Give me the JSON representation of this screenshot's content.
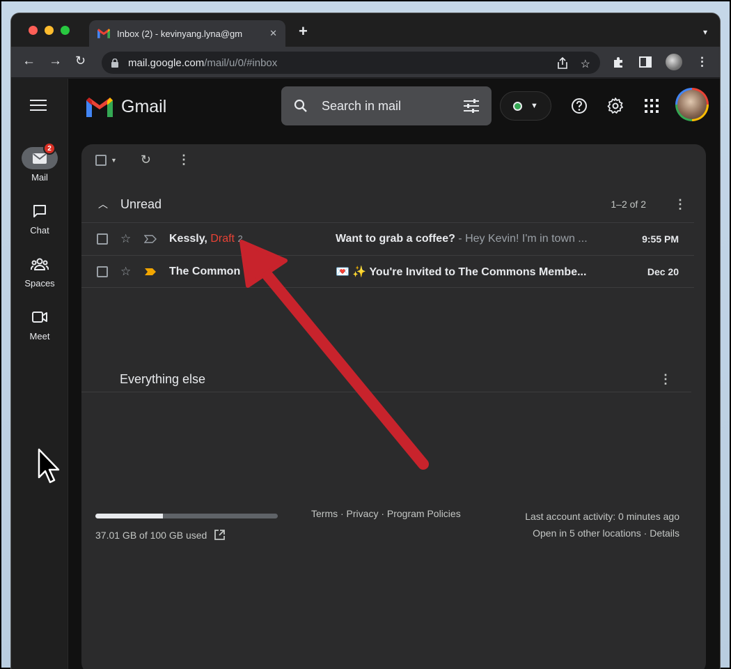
{
  "browser": {
    "tab_title": "Inbox (2) - kevinyang.lyna@gm",
    "tab_close": "✕",
    "new_tab": "+",
    "url_host": "mail.google.com",
    "url_path": "/mail/u/0/#inbox"
  },
  "rail": {
    "items": [
      {
        "label": "Mail",
        "icon": "mail-icon",
        "badge": "2"
      },
      {
        "label": "Chat",
        "icon": "chat-icon"
      },
      {
        "label": "Spaces",
        "icon": "spaces-icon"
      },
      {
        "label": "Meet",
        "icon": "meet-icon"
      }
    ]
  },
  "header": {
    "brand": "Gmail",
    "search_placeholder": "Search in mail"
  },
  "unread_section": {
    "title": "Unread",
    "count": "1–2 of 2"
  },
  "emails": [
    {
      "sender": "Kessly,",
      "draft": "Draft",
      "thread_count": "2",
      "subject": "Want to grab a coffee?",
      "snippet": " - Hey Kevin! I'm in town ...",
      "date": "9:55 PM",
      "important": false
    },
    {
      "sender": "The Common",
      "subject": "💌 ✨ You're Invited to The Commons Membe...",
      "date": "Dec 20",
      "important": true
    }
  ],
  "everything_section": {
    "title": "Everything else"
  },
  "footer": {
    "storage_text": "37.01 GB of 100 GB used",
    "storage_fraction": 0.37,
    "links": "Terms · Privacy · Program Policies",
    "activity": "Last account activity: 0 minutes ago",
    "locations": "Open in 5 other locations · Details"
  },
  "colors": {
    "accent_draft": "#e94235",
    "annotation_arrow": "#c8232c",
    "online_status": "#34a853"
  }
}
